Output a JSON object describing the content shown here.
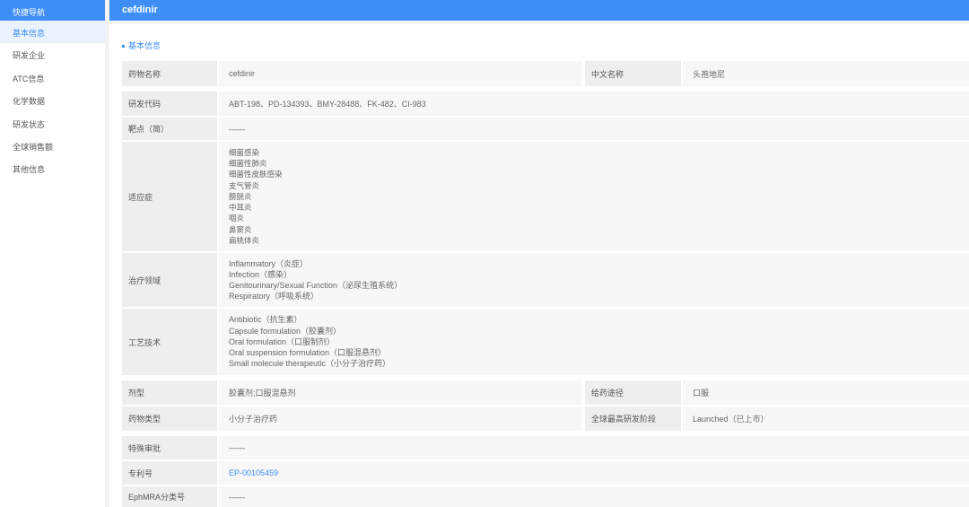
{
  "sidebar": {
    "header": "快捷导航",
    "items": [
      "基本信息",
      "研发企业",
      "ATC信息",
      "化学数据",
      "研发状态",
      "全球销售额",
      "其他信息"
    ]
  },
  "topbar": {
    "title": "cefdinir"
  },
  "section": {
    "title": "基本信息"
  },
  "fields": {
    "drug_name": {
      "label": "药物名称",
      "value": "cefdinir"
    },
    "chinese_name": {
      "label": "中文名称",
      "value": "头孢地尼"
    },
    "research_code": {
      "label": "研发代码",
      "value": "ABT-198、PD-134393、BMY-28488、FK-482、CI-983"
    },
    "target": {
      "label": "靶点（简）",
      "value": "——"
    },
    "indication": {
      "label": "适应症",
      "values": [
        "细菌感染",
        "细菌性肺炎",
        "细菌性皮肤感染",
        "支气管炎",
        "膀胱炎",
        "中耳炎",
        "咽炎",
        "鼻窦炎",
        "扁桃体炎"
      ]
    },
    "therapeutic_area": {
      "label": "治疗领域",
      "values": [
        "Inflammatory（炎症）",
        "Infection（感染）",
        "Genitourinary/Sexual Function（泌尿生殖系统）",
        "Respiratory（呼吸系统）"
      ]
    },
    "technology": {
      "label": "工艺技术",
      "values": [
        "Antibiotic（抗生素）",
        "Capsule formulation（胶囊剂）",
        "Oral formulation（口服制剂）",
        "Oral suspension formulation（口服混悬剂）",
        "Small molecule therapeutic（小分子治疗药）"
      ]
    },
    "dosage_form": {
      "label": "剂型",
      "value": "胶囊剂;口服混悬剂"
    },
    "route": {
      "label": "给药途径",
      "value": "口服"
    },
    "drug_type": {
      "label": "药物类型",
      "value": "小分子治疗药"
    },
    "highest_phase": {
      "label": "全球最高研发阶段",
      "value": "Launched（已上市）"
    },
    "special_approval": {
      "label": "特殊审批",
      "value": "——"
    },
    "patent": {
      "label": "专利号",
      "value": "EP-00105459"
    },
    "ephmra": {
      "label": "EphMRA分类号",
      "value": "——"
    }
  },
  "colors": {
    "accent": "#3e8ef7",
    "label_bg": "#eeeeee",
    "value_bg": "#f7f7f7"
  }
}
